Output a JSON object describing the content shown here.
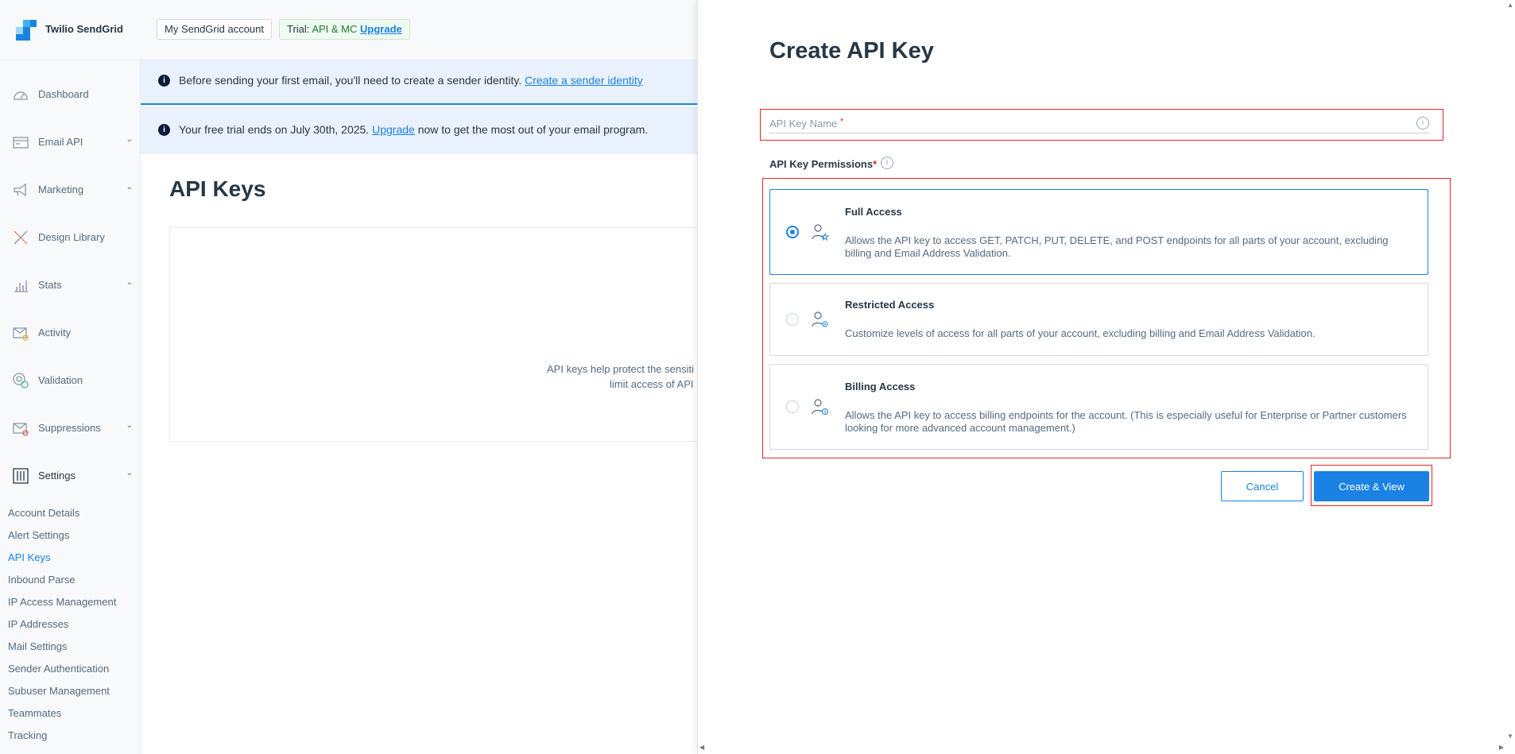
{
  "brand": {
    "name": "Twilio SendGrid"
  },
  "topbar": {
    "account_button": "My SendGrid account",
    "trial_prefix": "Trial:",
    "trial_plan": "API & MC",
    "trial_upgrade": "Upgrade"
  },
  "sidebar": {
    "items": [
      {
        "label": "Dashboard",
        "icon": "gauge-icon",
        "expandable": false
      },
      {
        "label": "Email API",
        "icon": "email-api-icon",
        "expandable": true
      },
      {
        "label": "Marketing",
        "icon": "megaphone-icon",
        "expandable": true
      },
      {
        "label": "Design Library",
        "icon": "design-tools-icon",
        "expandable": false
      },
      {
        "label": "Stats",
        "icon": "bar-chart-icon",
        "expandable": true
      },
      {
        "label": "Activity",
        "icon": "envelope-search-icon",
        "expandable": false
      },
      {
        "label": "Validation",
        "icon": "at-check-icon",
        "expandable": false
      },
      {
        "label": "Suppressions",
        "icon": "envelope-block-icon",
        "expandable": true
      },
      {
        "label": "Settings",
        "icon": "sliders-icon",
        "expandable": true
      }
    ],
    "settings_subitems": [
      "Account Details",
      "Alert Settings",
      "API Keys",
      "Inbound Parse",
      "IP Access Management",
      "IP Addresses",
      "Mail Settings",
      "Sender Authentication",
      "Subuser Management",
      "Teammates",
      "Tracking"
    ],
    "active_subitem": "API Keys"
  },
  "banners": {
    "sender": {
      "text": "Before sending your first email, you'll need to create a sender identity.",
      "link": "Create a sender identity"
    },
    "trial": {
      "text_before": "Your free trial ends on July 30th, 2025.",
      "link": "Upgrade",
      "text_after": "now to get the most out of your email program."
    }
  },
  "main": {
    "title": "API Keys",
    "empty_line1": "API keys help protect the sensiti",
    "empty_line2": "limit access of API"
  },
  "drawer": {
    "title": "Create API Key",
    "name_field": {
      "placeholder": "API Key Name",
      "required_mark": "*",
      "value": ""
    },
    "permissions_label": "API Key Permissions",
    "permissions_required_mark": "*",
    "options": [
      {
        "title": "Full Access",
        "description": "Allows the API key to access GET, PATCH, PUT, DELETE, and POST endpoints for all parts of your account, excluding billing and Email Address Validation.",
        "selected": true,
        "icon": "user-star-icon"
      },
      {
        "title": "Restricted Access",
        "description": "Customize levels of access for all parts of your account, excluding billing and Email Address Validation.",
        "selected": false,
        "icon": "user-gear-icon"
      },
      {
        "title": "Billing Access",
        "description": "Allows the API key to access billing endpoints for the account. (This is especially useful for Enterprise or Partner customers looking for more advanced account management.)",
        "selected": false,
        "icon": "user-dollar-icon"
      }
    ],
    "cancel_label": "Cancel",
    "create_label": "Create & View"
  },
  "colors": {
    "accent": "#1a82e2",
    "highlight_outline": "#e4252b",
    "banner_bg": "#e9f2fc",
    "sidebar_bg": "#f7f9fa"
  }
}
